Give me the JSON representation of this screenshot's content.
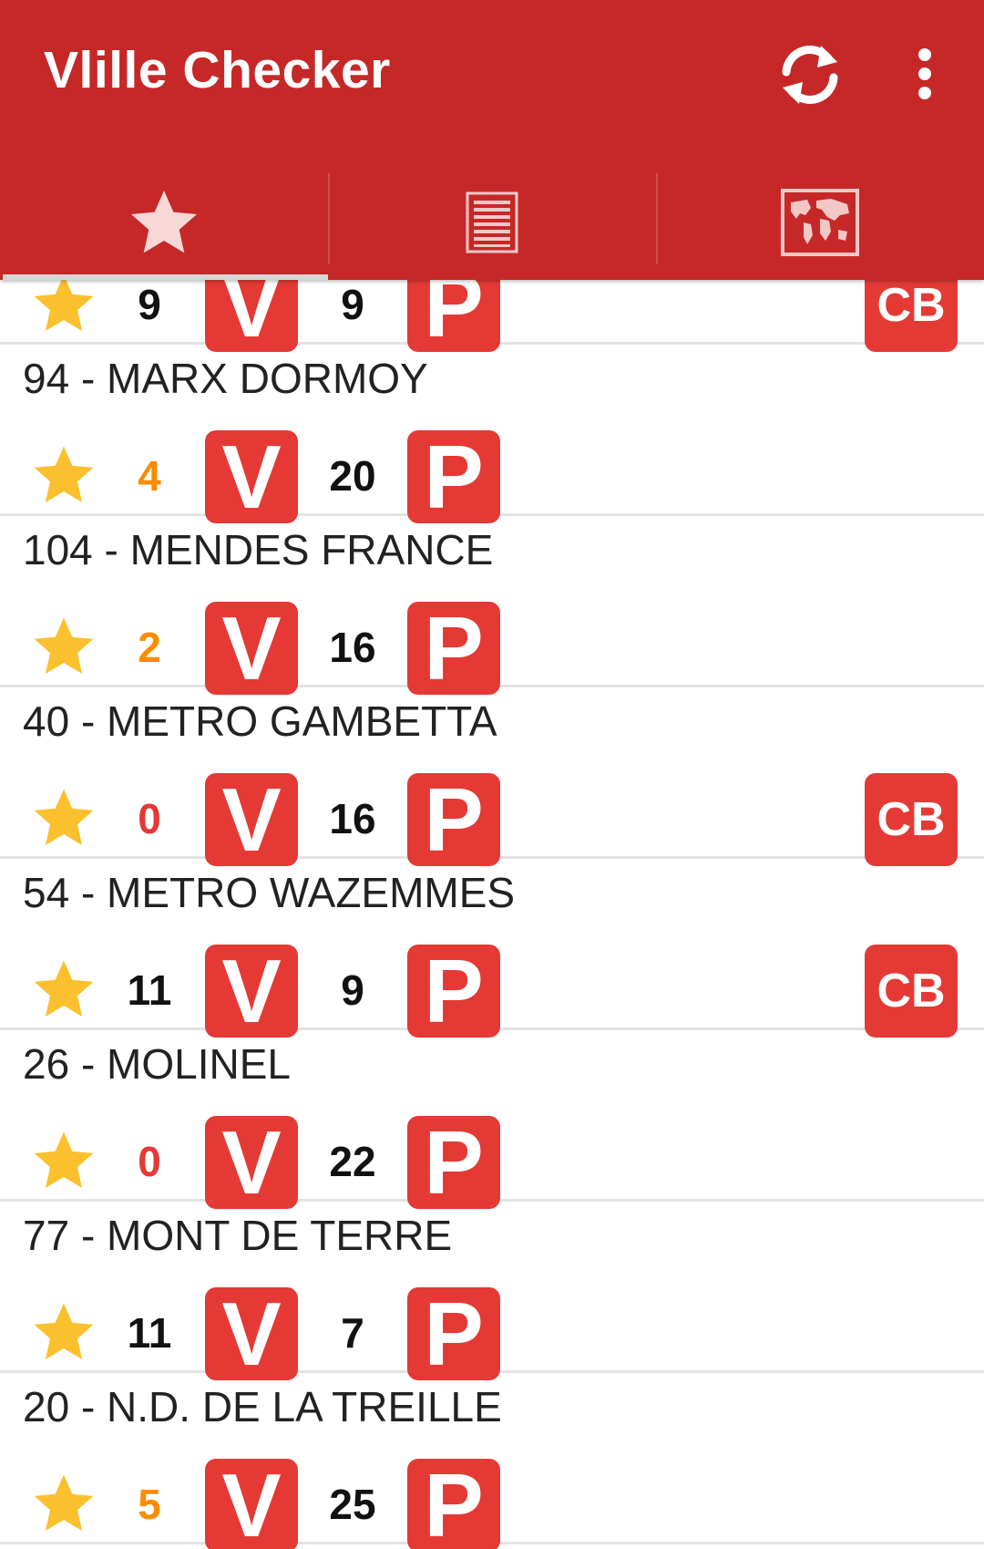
{
  "app": {
    "title": "Vlille Checker"
  },
  "toolbar": {
    "refresh_icon": "refresh-icon",
    "overflow_icon": "more-vert-icon"
  },
  "tabs": [
    {
      "icon": "star-icon",
      "selected": true
    },
    {
      "icon": "list-icon",
      "selected": false
    },
    {
      "icon": "map-icon",
      "selected": false
    }
  ],
  "labels": {
    "bikes_badge": "V",
    "places_badge": "P",
    "card_badge": "CB"
  },
  "colors": {
    "primary": "#c62828",
    "badge": "#e53935",
    "star": "#fbc02d",
    "low": "#fb8c00",
    "empty": "#e53935",
    "normal": "#111111"
  },
  "stations": [
    {
      "name": "",
      "bikes": "9",
      "places": "9",
      "card": true,
      "status": "normal"
    },
    {
      "name": "94 - MARX DORMOY",
      "bikes": "4",
      "places": "20",
      "card": false,
      "status": "low"
    },
    {
      "name": "104 - MENDES FRANCE",
      "bikes": "2",
      "places": "16",
      "card": false,
      "status": "low"
    },
    {
      "name": "40 - METRO GAMBETTA",
      "bikes": "0",
      "places": "16",
      "card": true,
      "status": "empty"
    },
    {
      "name": "54 - METRO WAZEMMES",
      "bikes": "11",
      "places": "9",
      "card": true,
      "status": "normal"
    },
    {
      "name": "26 - MOLINEL",
      "bikes": "0",
      "places": "22",
      "card": false,
      "status": "empty"
    },
    {
      "name": "77 - MONT DE TERRE",
      "bikes": "11",
      "places": "7",
      "card": false,
      "status": "normal"
    },
    {
      "name": "20 - N.D. DE LA TREILLE",
      "bikes": "5",
      "places": "25",
      "card": false,
      "status": "low"
    }
  ]
}
